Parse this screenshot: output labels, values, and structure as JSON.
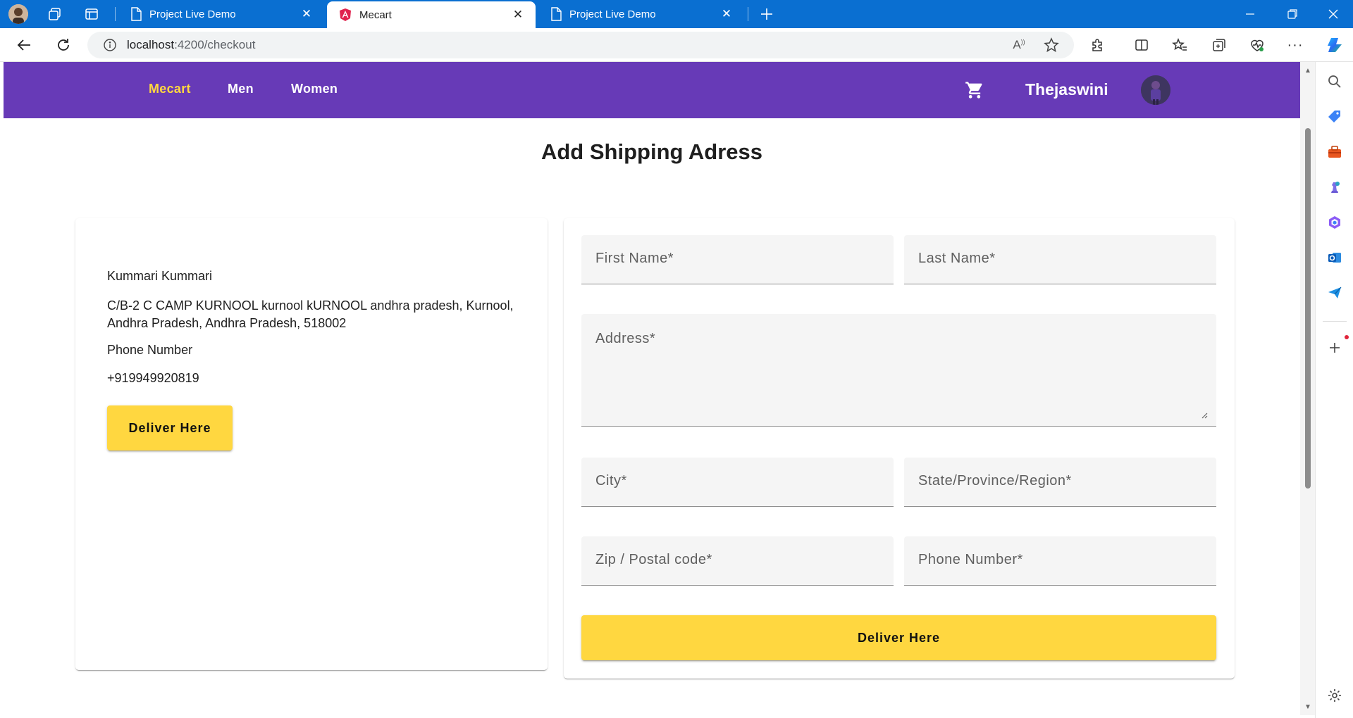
{
  "browser": {
    "tabs": [
      {
        "title": "Project Live Demo",
        "active": false
      },
      {
        "title": "Mecart",
        "active": true
      },
      {
        "title": "Project Live Demo",
        "active": false
      }
    ],
    "url_host": "localhost",
    "url_path": ":4200/checkout"
  },
  "navbar": {
    "brand": "Mecart",
    "links": [
      "Men",
      "Women"
    ],
    "username": "Thejaswini",
    "brand_color": "#ffd740",
    "bar_color": "#673ab7"
  },
  "page": {
    "title": "Add Shipping Adress"
  },
  "saved_address": {
    "name": "Kummari Kummari",
    "address": "C/B-2 C CAMP KURNOOL kurnool kURNOOL andhra pradesh, Kurnool, Andhra Pradesh, Andhra Pradesh, 518002",
    "phone_label": "Phone Number",
    "phone": "+919949920819",
    "button_label": "Deliver Here"
  },
  "form": {
    "first_name": "First Name*",
    "last_name": "Last Name*",
    "address": "Address*",
    "city": "City*",
    "state": "State/Province/Region*",
    "zip": "Zip / Postal code*",
    "phone": "Phone Number*",
    "submit_label": "Deliver Here",
    "accent_color": "#ffd740"
  }
}
